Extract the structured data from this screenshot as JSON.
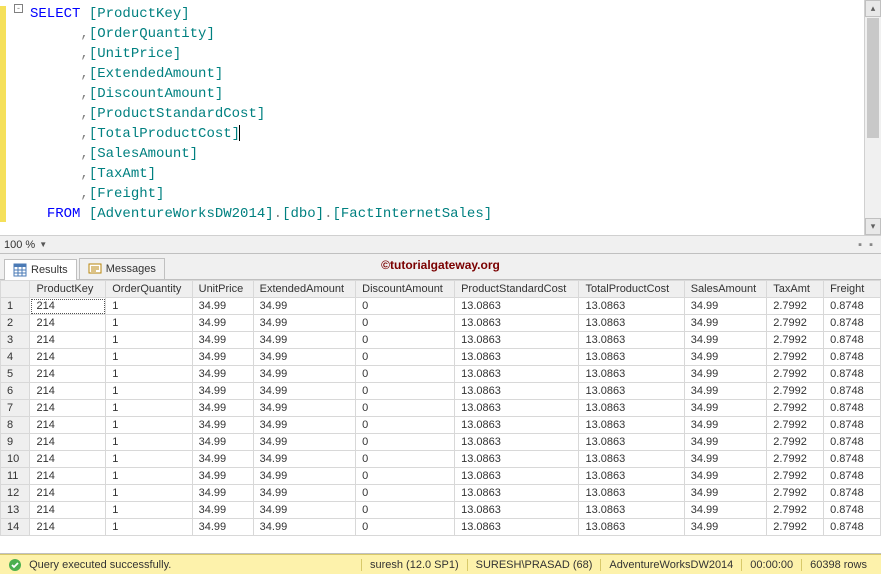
{
  "editor": {
    "outline_toggle": "-",
    "code_lines": [
      {
        "segments": [
          {
            "t": "SELECT ",
            "c": "kw"
          },
          {
            "t": "[ProductKey]",
            "c": "obj"
          }
        ]
      },
      {
        "segments": [
          {
            "t": "      ",
            "c": ""
          },
          {
            "t": ",",
            "c": "op"
          },
          {
            "t": "[OrderQuantity]",
            "c": "obj"
          }
        ]
      },
      {
        "segments": [
          {
            "t": "      ",
            "c": ""
          },
          {
            "t": ",",
            "c": "op"
          },
          {
            "t": "[UnitPrice]",
            "c": "obj"
          }
        ]
      },
      {
        "segments": [
          {
            "t": "      ",
            "c": ""
          },
          {
            "t": ",",
            "c": "op"
          },
          {
            "t": "[ExtendedAmount]",
            "c": "obj"
          }
        ]
      },
      {
        "segments": [
          {
            "t": "      ",
            "c": ""
          },
          {
            "t": ",",
            "c": "op"
          },
          {
            "t": "[DiscountAmount]",
            "c": "obj"
          }
        ]
      },
      {
        "segments": [
          {
            "t": "      ",
            "c": ""
          },
          {
            "t": ",",
            "c": "op"
          },
          {
            "t": "[ProductStandardCost]",
            "c": "obj"
          }
        ]
      },
      {
        "segments": [
          {
            "t": "      ",
            "c": ""
          },
          {
            "t": ",",
            "c": "op"
          },
          {
            "t": "[TotalProductCost]",
            "c": "obj"
          },
          {
            "t": "|",
            "c": "caret-marker"
          }
        ]
      },
      {
        "segments": [
          {
            "t": "      ",
            "c": ""
          },
          {
            "t": ",",
            "c": "op"
          },
          {
            "t": "[SalesAmount]",
            "c": "obj"
          }
        ]
      },
      {
        "segments": [
          {
            "t": "      ",
            "c": ""
          },
          {
            "t": ",",
            "c": "op"
          },
          {
            "t": "[TaxAmt]",
            "c": "obj"
          }
        ]
      },
      {
        "segments": [
          {
            "t": "      ",
            "c": ""
          },
          {
            "t": ",",
            "c": "op"
          },
          {
            "t": "[Freight]",
            "c": "obj"
          }
        ]
      },
      {
        "segments": [
          {
            "t": "  ",
            "c": ""
          },
          {
            "t": "FROM ",
            "c": "kw"
          },
          {
            "t": "[AdventureWorksDW2014]",
            "c": "obj"
          },
          {
            "t": ".",
            "c": "op"
          },
          {
            "t": "[dbo]",
            "c": "obj"
          },
          {
            "t": ".",
            "c": "op"
          },
          {
            "t": "[FactInternetSales]",
            "c": "obj"
          }
        ]
      }
    ]
  },
  "zoom": {
    "level": "100 %"
  },
  "tabs": {
    "results_label": "Results",
    "messages_label": "Messages",
    "watermark": "©tutorialgateway.org"
  },
  "grid": {
    "columns": [
      "ProductKey",
      "OrderQuantity",
      "UnitPrice",
      "ExtendedAmount",
      "DiscountAmount",
      "ProductStandardCost",
      "TotalProductCost",
      "SalesAmount",
      "TaxAmt",
      "Freight"
    ],
    "rows": [
      [
        "214",
        "1",
        "34.99",
        "34.99",
        "0",
        "13.0863",
        "13.0863",
        "34.99",
        "2.7992",
        "0.8748"
      ],
      [
        "214",
        "1",
        "34.99",
        "34.99",
        "0",
        "13.0863",
        "13.0863",
        "34.99",
        "2.7992",
        "0.8748"
      ],
      [
        "214",
        "1",
        "34.99",
        "34.99",
        "0",
        "13.0863",
        "13.0863",
        "34.99",
        "2.7992",
        "0.8748"
      ],
      [
        "214",
        "1",
        "34.99",
        "34.99",
        "0",
        "13.0863",
        "13.0863",
        "34.99",
        "2.7992",
        "0.8748"
      ],
      [
        "214",
        "1",
        "34.99",
        "34.99",
        "0",
        "13.0863",
        "13.0863",
        "34.99",
        "2.7992",
        "0.8748"
      ],
      [
        "214",
        "1",
        "34.99",
        "34.99",
        "0",
        "13.0863",
        "13.0863",
        "34.99",
        "2.7992",
        "0.8748"
      ],
      [
        "214",
        "1",
        "34.99",
        "34.99",
        "0",
        "13.0863",
        "13.0863",
        "34.99",
        "2.7992",
        "0.8748"
      ],
      [
        "214",
        "1",
        "34.99",
        "34.99",
        "0",
        "13.0863",
        "13.0863",
        "34.99",
        "2.7992",
        "0.8748"
      ],
      [
        "214",
        "1",
        "34.99",
        "34.99",
        "0",
        "13.0863",
        "13.0863",
        "34.99",
        "2.7992",
        "0.8748"
      ],
      [
        "214",
        "1",
        "34.99",
        "34.99",
        "0",
        "13.0863",
        "13.0863",
        "34.99",
        "2.7992",
        "0.8748"
      ],
      [
        "214",
        "1",
        "34.99",
        "34.99",
        "0",
        "13.0863",
        "13.0863",
        "34.99",
        "2.7992",
        "0.8748"
      ],
      [
        "214",
        "1",
        "34.99",
        "34.99",
        "0",
        "13.0863",
        "13.0863",
        "34.99",
        "2.7992",
        "0.8748"
      ],
      [
        "214",
        "1",
        "34.99",
        "34.99",
        "0",
        "13.0863",
        "13.0863",
        "34.99",
        "2.7992",
        "0.8748"
      ],
      [
        "214",
        "1",
        "34.99",
        "34.99",
        "0",
        "13.0863",
        "13.0863",
        "34.99",
        "2.7992",
        "0.8748"
      ]
    ]
  },
  "status": {
    "message": "Query executed successfully.",
    "server": "suresh (12.0 SP1)",
    "user": "SURESH\\PRASAD (68)",
    "database": "AdventureWorksDW2014",
    "elapsed": "00:00:00",
    "rows": "60398 rows"
  }
}
